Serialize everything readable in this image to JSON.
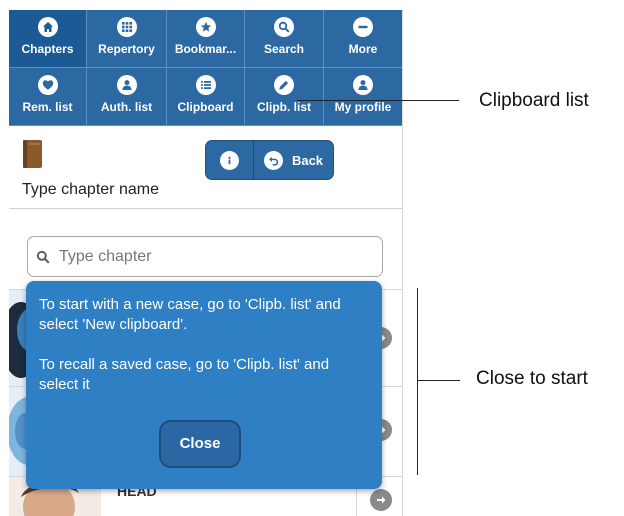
{
  "nav": {
    "items": [
      {
        "label": "Chapters",
        "icon": "home-icon",
        "active": true
      },
      {
        "label": "Repertory",
        "icon": "grid-icon",
        "active": false
      },
      {
        "label": "Bookmar...",
        "icon": "star-icon",
        "active": false
      },
      {
        "label": "Search",
        "icon": "search-icon",
        "active": false
      },
      {
        "label": "More",
        "icon": "minus-icon",
        "active": false
      },
      {
        "label": "Rem. list",
        "icon": "heart-icon",
        "active": false
      },
      {
        "label": "Auth. list",
        "icon": "person-icon",
        "active": false
      },
      {
        "label": "Clipboard",
        "icon": "list-icon",
        "active": false
      },
      {
        "label": "Clipb. list",
        "icon": "pencil-icon",
        "active": false
      },
      {
        "label": "My profile",
        "icon": "person-icon",
        "active": false
      }
    ]
  },
  "header": {
    "chapter_title": "Type chapter name",
    "back_label": "Back"
  },
  "search": {
    "placeholder": "Type chapter"
  },
  "list": {
    "visible_row_label": "HEAD"
  },
  "popup": {
    "line1": "To start with a new case, go to 'Clipb. list' and select 'New clipboard'.",
    "line2": "To recall a saved case, go to 'Clipb. list' and select it",
    "close_label": "Close"
  },
  "annotations": {
    "clipboard_list": "Clipboard list",
    "close_to_start": "Close to start"
  },
  "colors": {
    "nav_bg": "#2c69a3",
    "popup_bg": "#2f7fc4",
    "accent_dark": "#1c5a96"
  }
}
